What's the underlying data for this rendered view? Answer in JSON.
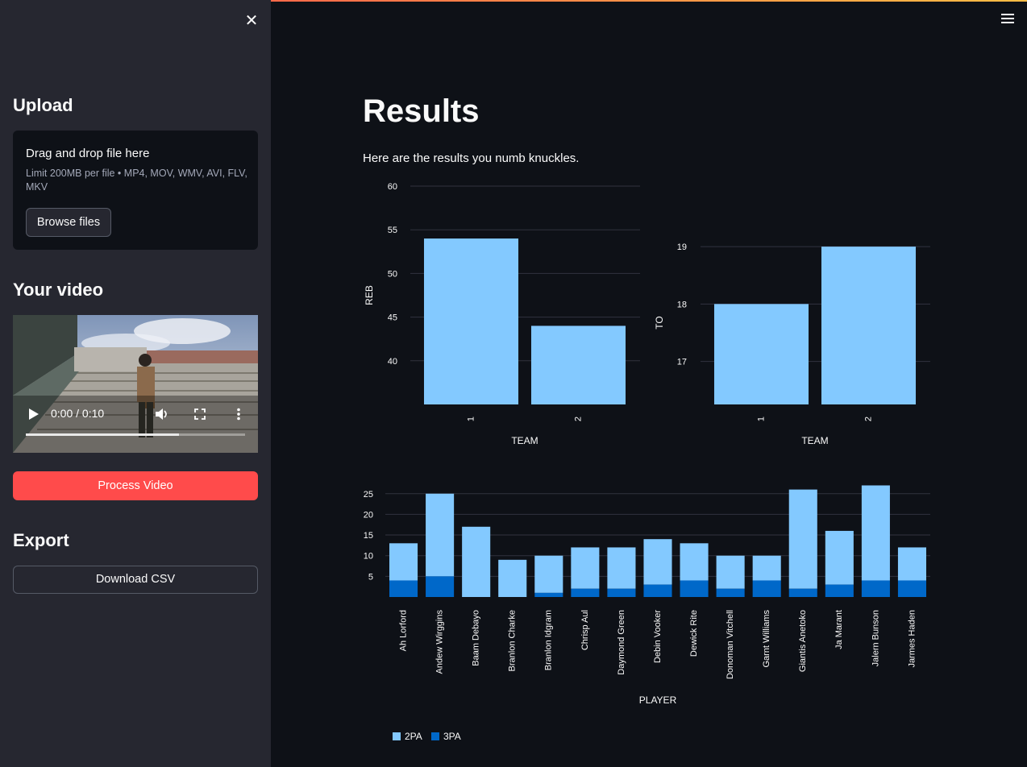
{
  "sidebar": {
    "upload_heading": "Upload",
    "uploader": {
      "title": "Drag and drop file here",
      "limit": "Limit 200MB per file • MP4, MOV, WMV, AVI, FLV, MKV",
      "browse_label": "Browse files"
    },
    "video_heading": "Your video",
    "video": {
      "time": "0:00 / 0:10",
      "progress": 0.7
    },
    "process_label": "Process Video",
    "export_heading": "Export",
    "download_label": "Download CSV"
  },
  "main": {
    "title": "Results",
    "subtitle": "Here are the results you numb knuckles."
  },
  "colors": {
    "bar_light": "#83c9ff",
    "bar_dark": "#0068c9",
    "accent": "#ff4b4b"
  },
  "chart_data": [
    {
      "type": "bar",
      "categories": [
        "1",
        "2"
      ],
      "values": [
        54,
        44
      ],
      "xlabel": "TEAM",
      "ylabel": "REB",
      "ylim": [
        35,
        60
      ],
      "yticks": [
        40,
        45,
        50,
        55,
        60
      ],
      "grid": true
    },
    {
      "type": "bar",
      "categories": [
        "1",
        "2"
      ],
      "values": [
        18,
        19
      ],
      "xlabel": "TEAM",
      "ylabel": "TO",
      "ylim": [
        16.25,
        19.1
      ],
      "yticks": [
        17,
        18,
        19
      ],
      "grid": true
    },
    {
      "type": "bar",
      "stacked": true,
      "categories": [
        "Ah Lorford",
        "Andew Wirggins",
        "Baam Debayo",
        "Branlon Charke",
        "Branlon Idgram",
        "Chrisp Aul",
        "Daymond Green",
        "Debin Vooker",
        "Dewick Rite",
        "Donoman Vitchell",
        "Garnt Williams",
        "Giantis Anetoko",
        "Ja Marant",
        "Jalern Bunson",
        "Jarmes Haden"
      ],
      "series": [
        {
          "name": "3PA",
          "values": [
            4,
            5,
            0,
            0,
            1,
            2,
            2,
            3,
            4,
            2,
            4,
            2,
            3,
            4,
            4
          ]
        },
        {
          "name": "2PA",
          "values": [
            9,
            20,
            17,
            9,
            9,
            10,
            10,
            11,
            9,
            8,
            6,
            24,
            13,
            23,
            8
          ]
        }
      ],
      "xlabel": "PLAYER",
      "ylabel": "",
      "ylim": [
        0,
        28
      ],
      "yticks": [
        5,
        10,
        15,
        20,
        25
      ],
      "legend": "bottom-left",
      "legend_order": [
        "2PA",
        "3PA"
      ],
      "grid": true
    }
  ]
}
